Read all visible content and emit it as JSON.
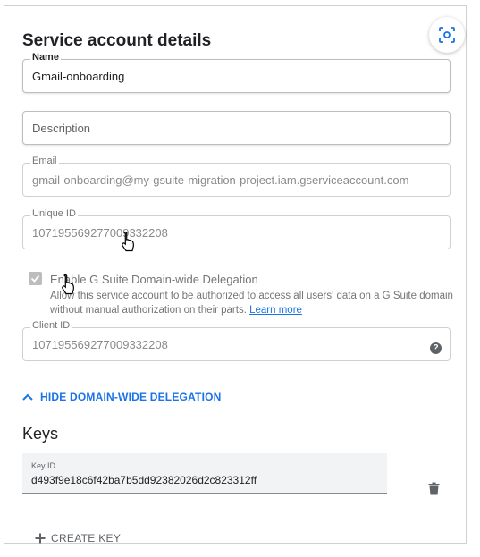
{
  "title": "Service account details",
  "fields": {
    "name": {
      "label": "Name",
      "value": "Gmail-onboarding"
    },
    "description": {
      "placeholder": "Description"
    },
    "email": {
      "label": "Email",
      "value": "gmail-onboarding@my-gsuite-migration-project.iam.gserviceaccount.com"
    },
    "unique_id": {
      "label": "Unique ID",
      "value": "107195569277009332208"
    },
    "client_id": {
      "label": "Client ID",
      "value": "107195569277009332208"
    }
  },
  "delegation": {
    "checkbox_label": "Enable G Suite Domain-wide Delegation",
    "description": "Allow this service account to be authorized to access all users' data on a G Suite domain without manual authorization on their parts.",
    "learn_more": "Learn more",
    "checked": true,
    "toggle_label": "HIDE DOMAIN-WIDE DELEGATION"
  },
  "keys": {
    "title": "Keys",
    "key_id_label": "Key ID",
    "key_id_value": "d493f9e18c6f42ba7b5dd92382026d2c823312ff",
    "create_label": "CREATE KEY"
  },
  "icons": {
    "lens": "lens-icon",
    "help": "help-icon",
    "chevron": "chevron-up-icon",
    "trash": "trash-icon",
    "plus": "plus-icon",
    "cursor": "hand-cursor-icon"
  },
  "colors": {
    "accent": "#1a73e8",
    "text": "#202124",
    "muted": "#757575"
  }
}
